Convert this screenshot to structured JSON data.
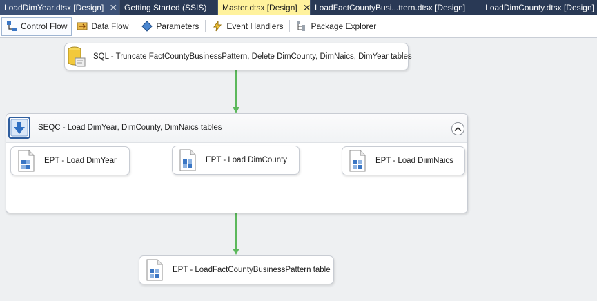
{
  "doc_tabs": [
    {
      "label": "LoadDimYear.dtsx [Design]",
      "close": "✕"
    },
    {
      "label": "Getting Started (SSIS)"
    },
    {
      "label": "Master.dtsx [Design]",
      "close": "✕"
    },
    {
      "label": "LoadFactCountyBusi...ttern.dtsx [Design]"
    },
    {
      "label": "LoadDimCounty.dtsx [Design]"
    }
  ],
  "designer_tabs": [
    {
      "label": "Control Flow",
      "icon": "control-flow-icon"
    },
    {
      "label": "Data Flow",
      "icon": "data-flow-icon"
    },
    {
      "label": "Parameters",
      "icon": "parameters-icon"
    },
    {
      "label": "Event Handlers",
      "icon": "event-handlers-icon"
    },
    {
      "label": "Package Explorer",
      "icon": "package-explorer-icon"
    }
  ],
  "tasks": {
    "sql": {
      "label": "SQL - Truncate FactCountyBusinessPattern, Delete DimCounty, DimNaics, DimYear tables",
      "icon": "execute-sql-icon"
    },
    "seqc": {
      "label": "SEQC - Load DimYear, DimCounty, DimNaics tables",
      "icon": "sequence-container-icon"
    },
    "ept_year": {
      "label": "EPT - Load DimYear",
      "icon": "execute-package-icon"
    },
    "ept_county": {
      "label": "EPT - Load DimCounty",
      "icon": "execute-package-icon"
    },
    "ept_naics": {
      "label": "EPT - Load DiimNaics",
      "icon": "execute-package-icon"
    },
    "ept_fact": {
      "label": "EPT - LoadFactCountyBusinessPattern table",
      "icon": "execute-package-icon"
    }
  },
  "colors": {
    "tab_bar": "#293955",
    "active_tab": "#fff29d",
    "precedence_constraint": "#5cb85c"
  }
}
